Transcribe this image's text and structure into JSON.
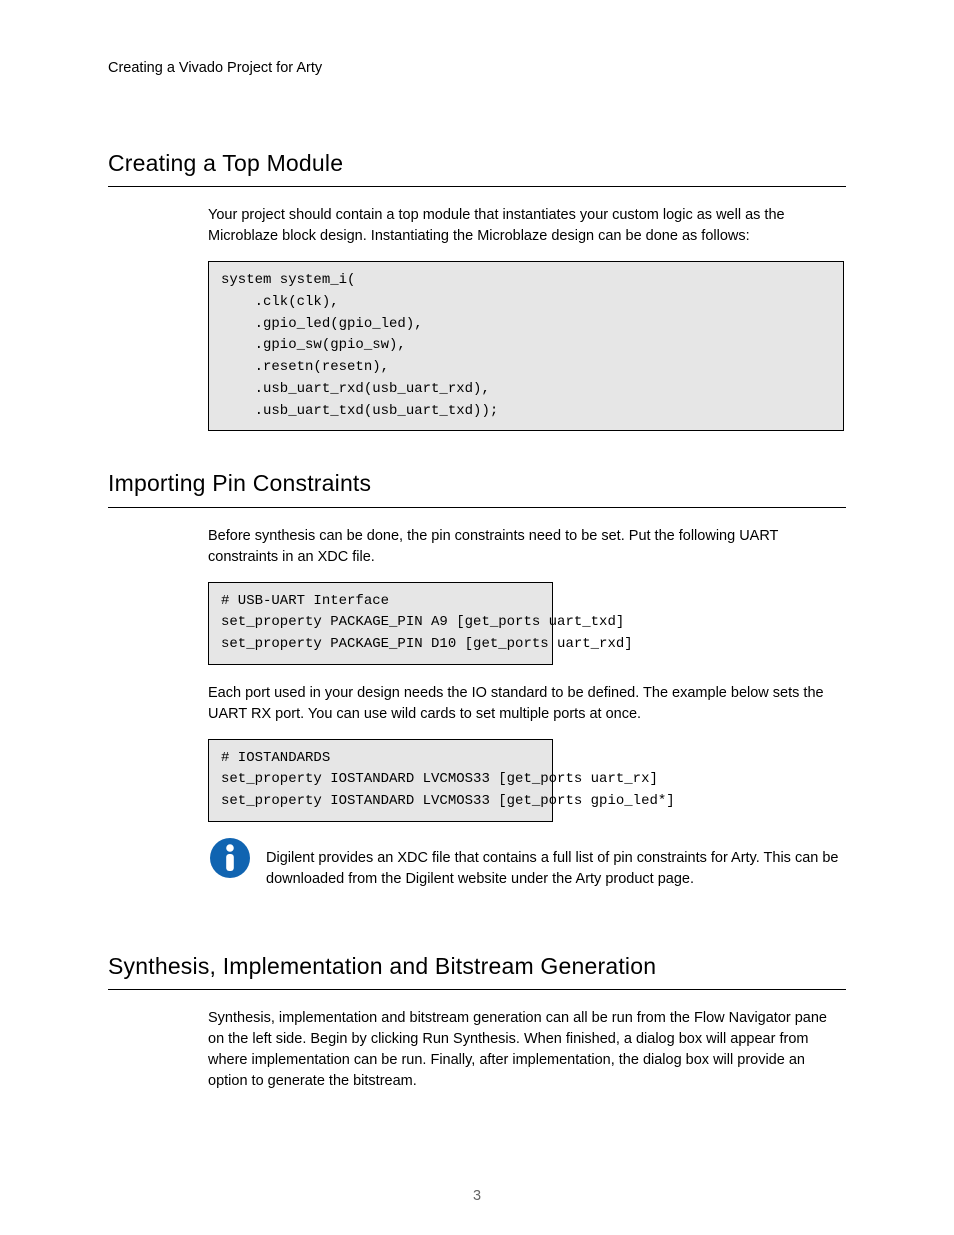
{
  "docTitle": "Creating a Vivado Project for Arty",
  "section1": {
    "heading": "Creating a Top Module",
    "intro": "Your project should contain a top module that instantiates your custom logic as well as the Microblaze block design. Instantiating the Microblaze design can be done as follows:",
    "code": "system system_i(\n    .clk(clk),\n    .gpio_led(gpio_led),\n    .gpio_sw(gpio_sw),\n    .resetn(resetn),\n    .usb_uart_rxd(usb_uart_rxd),\n    .usb_uart_txd(usb_uart_txd));"
  },
  "section2": {
    "heading": "Importing Pin Constraints",
    "intro": "Before synthesis can be done, the pin constraints need to be set. Put the following UART constraints in an XDC file.",
    "code1": "# USB-UART Interface\nset_property PACKAGE_PIN A9 [get_ports uart_txd]\nset_property PACKAGE_PIN D10 [get_ports uart_rxd]",
    "mid": "Each port used in your design needs the IO standard to be defined. The example below sets the UART RX port. You can use wild cards to set multiple ports at once.",
    "code2": "# IOSTANDARDS\nset_property IOSTANDARD LVCMOS33 [get_ports uart_rx]\nset_property IOSTANDARD LVCMOS33 [get_ports gpio_led*]",
    "note": "Digilent provides an XDC file that contains a full list of pin constraints for Arty. This can be downloaded from the Digilent website under the Arty product page."
  },
  "section3": {
    "heading": "Synthesis, Implementation and Bitstream Generation",
    "body": "Synthesis, implementation and bitstream generation can all be run from the Flow Navigator pane on the left side. Begin by clicking Run Synthesis. When finished, a dialog box will appear from where implementation can be run. Finally, after implementation, the dialog box will provide an option to generate the bitstream."
  },
  "pageNumber": "3"
}
